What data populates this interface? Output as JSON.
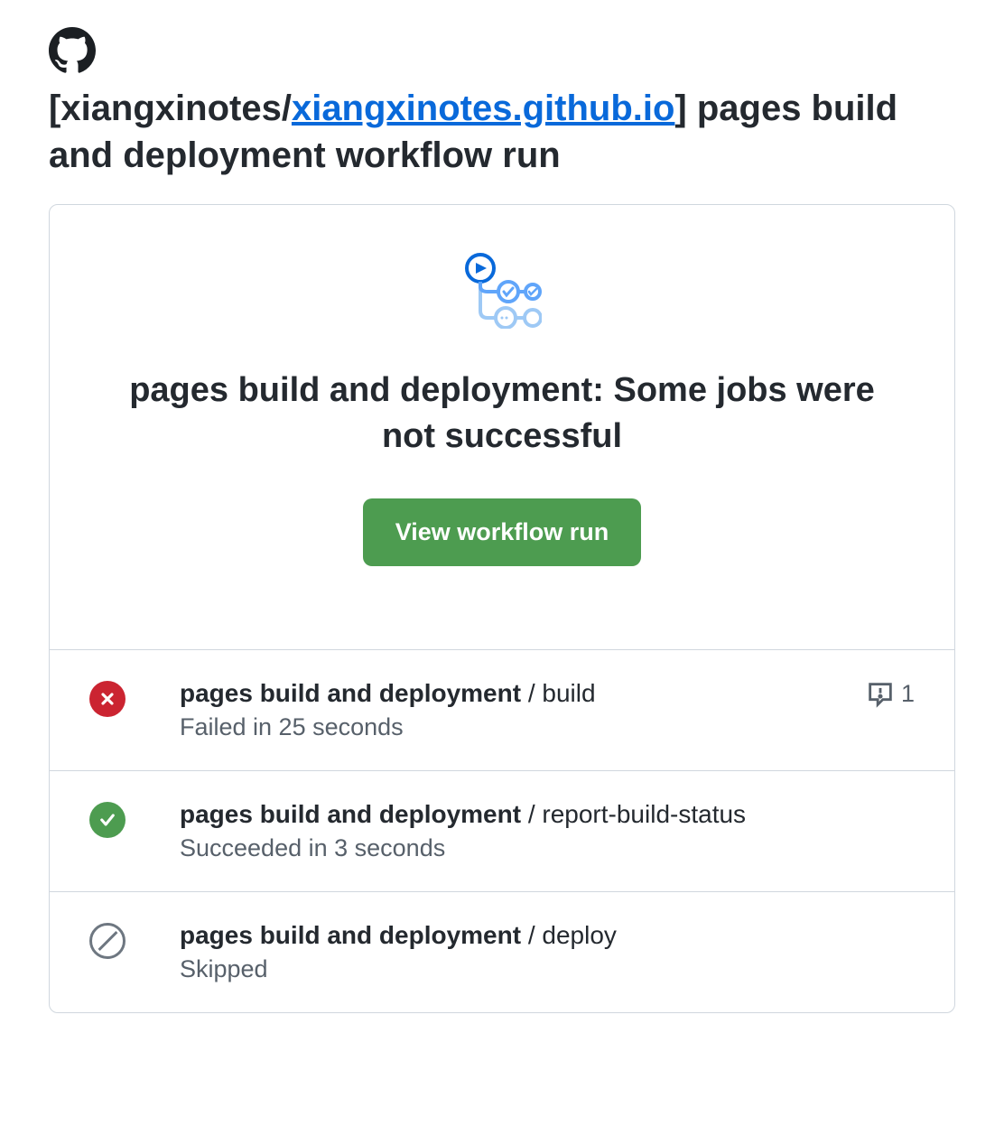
{
  "header": {
    "title_prefix": "[",
    "repo_owner": "xiangxinotes/",
    "repo_name_link": "xiangxinotes.github.io",
    "title_suffix": "] pages build and deployment workflow run"
  },
  "card": {
    "title": "pages build and deployment: Some jobs were not successful",
    "button_label": "View workflow run"
  },
  "jobs": [
    {
      "status": "failed",
      "workflow_name": "pages build and deployment",
      "job_name": "build",
      "result_text": "Failed in 25 seconds",
      "annotation_count": "1"
    },
    {
      "status": "success",
      "workflow_name": "pages build and deployment",
      "job_name": "report-build-status",
      "result_text": "Succeeded in 3 seconds",
      "annotation_count": null
    },
    {
      "status": "skipped",
      "workflow_name": "pages build and deployment",
      "job_name": "deploy",
      "result_text": "Skipped",
      "annotation_count": null
    }
  ]
}
